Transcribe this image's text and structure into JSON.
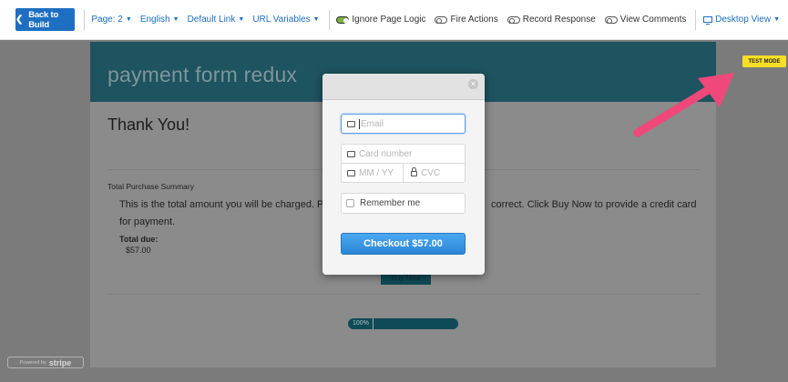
{
  "toolbar": {
    "back_label": "Back to Build",
    "page_label": "Page: 2",
    "language_label": "English",
    "link_label": "Default Link",
    "url_vars_label": "URL Variables",
    "toggles": [
      {
        "label": "Ignore Page Logic",
        "on": true
      },
      {
        "label": "Fire Actions",
        "on": false
      },
      {
        "label": "Record Response",
        "on": false
      },
      {
        "label": "View Comments",
        "on": false
      }
    ],
    "view_label": "Desktop View"
  },
  "survey": {
    "form_title": "payment form redux",
    "thank_you": "Thank You!",
    "summary_title": "Total Purchase Summary",
    "summary_text_left": "This is the total amount you will be charged. Ple",
    "summary_text_right": "correct. Click Buy Now to provide a credit card",
    "summary_text_line2": "for payment.",
    "total_due_label": "Total due:",
    "total_due_value": "$57.00",
    "buy_label": "Buy Now",
    "progress_label": "100%",
    "progress_value": 1.0
  },
  "badge": {
    "test_mode": "TEST MODE"
  },
  "powered": {
    "prefix": "Powered by",
    "brand": "stripe"
  },
  "modal": {
    "email_placeholder": "Email",
    "card_placeholder": "Card number",
    "exp_placeholder": "MM / YY",
    "cvc_placeholder": "CVC",
    "remember_label": "Remember me",
    "checkout_label": "Checkout $57.00"
  },
  "colors": {
    "accent": "#1e6fc1",
    "header": "#1e5360",
    "checkout": "#2b86d6",
    "badge": "#f9df25",
    "arrow": "#f0487a"
  }
}
